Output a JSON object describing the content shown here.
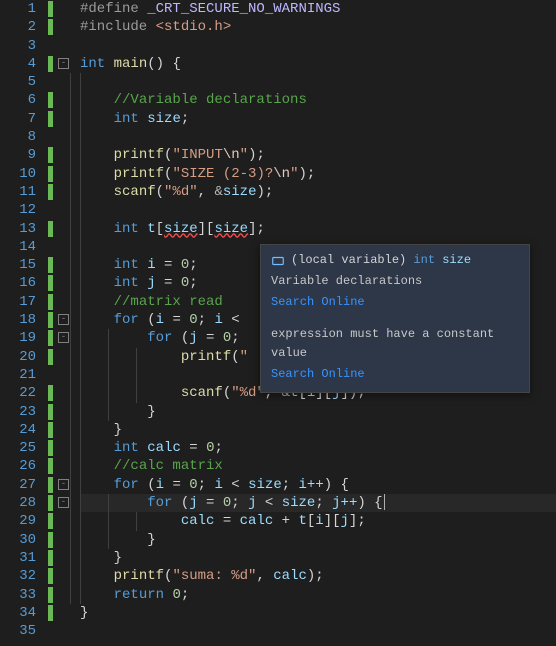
{
  "lines": {
    "start": 1,
    "count": 35
  },
  "mod_bars": [
    1,
    2,
    4,
    6,
    7,
    9,
    10,
    11,
    13,
    15,
    16,
    17,
    18,
    19,
    20,
    22,
    23,
    24,
    25,
    26,
    27,
    28,
    29,
    30,
    31,
    32,
    33,
    34
  ],
  "folds": {
    "4": "-",
    "18": "-",
    "19": "-",
    "27": "-",
    "28": "-"
  },
  "code": {
    "l1": {
      "define": "#define",
      "macro": "_CRT_SECURE_NO_WARNINGS"
    },
    "l2": {
      "include": "#include",
      "hdr": "<stdio.h>"
    },
    "l4": {
      "kw": "int",
      "fn": "main"
    },
    "l6": {
      "com": "//Variable declarations"
    },
    "l7": {
      "kw": "int",
      "var": "size"
    },
    "l9": {
      "fn": "printf",
      "s1": "\"INPUT",
      "esc": "\\n",
      "s2": "\""
    },
    "l10": {
      "fn": "printf",
      "s1": "\"SIZE (2-3)?",
      "esc": "\\n",
      "s2": "\""
    },
    "l11": {
      "fn": "scanf",
      "fmt": "\"%d\"",
      "amp": "&",
      "var": "size"
    },
    "l13": {
      "kw": "int",
      "var": "t",
      "a": "size",
      "b": "size"
    },
    "l15": {
      "kw": "int",
      "var": "i",
      "val": "0"
    },
    "l16": {
      "kw": "int",
      "var": "j",
      "val": "0"
    },
    "l17": {
      "com": "//matrix read"
    },
    "l18": {
      "kw": "for",
      "v": "i",
      "z": "0",
      "v2": "i"
    },
    "l19": {
      "kw": "for",
      "v": "j",
      "z": "0"
    },
    "l20": {
      "fn": "printf",
      "tail": ";"
    },
    "l22": {
      "fn": "scanf",
      "fmt": "\"%d\"",
      "amp": "&",
      "var": "t",
      "i": "i",
      "j": "j"
    },
    "l25": {
      "kw": "int",
      "var": "calc",
      "val": "0"
    },
    "l26": {
      "com": "//calc matrix"
    },
    "l27": {
      "kw": "for",
      "v": "i",
      "z": "0",
      "v2": "i",
      "s": "size",
      "inc": "i++"
    },
    "l28": {
      "kw": "for",
      "v": "j",
      "z": "0",
      "v2": "j",
      "s": "size",
      "inc": "j++"
    },
    "l29": {
      "v": "calc",
      "t": "t",
      "i": "i",
      "j": "j"
    },
    "l32": {
      "fn": "printf",
      "fmt": "\"suma: %d\"",
      "var": "calc"
    },
    "l33": {
      "kw": "return",
      "val": "0"
    }
  },
  "tooltip": {
    "scope": "(local variable)",
    "type": "int",
    "name": "size",
    "desc": "Variable declarations",
    "link1": "Search Online",
    "error": "expression must have a constant value",
    "link2": "Search Online"
  }
}
